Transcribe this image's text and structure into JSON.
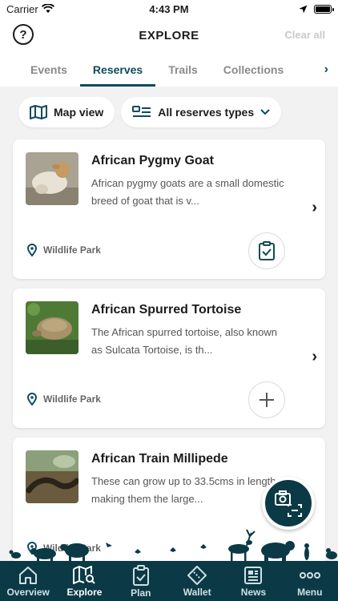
{
  "status": {
    "carrier": "Carrier",
    "time": "4:43 PM"
  },
  "header": {
    "title": "EXPLORE",
    "clear_all": "Clear all",
    "help": "?"
  },
  "tabs": [
    {
      "label": "Events"
    },
    {
      "label": "Reserves"
    },
    {
      "label": "Trails"
    },
    {
      "label": "Collections"
    }
  ],
  "filters": {
    "map_view": "Map view",
    "type_select": "All reserves types"
  },
  "cards": [
    {
      "title": "African Pygmy Goat",
      "desc": "African pygmy goats are a small domestic breed of goat that is v...",
      "location": "Wildlife Park",
      "action_icon": "clipboard-check-icon"
    },
    {
      "title": "African Spurred Tortoise",
      "desc": "The African spurred tortoise, also known as Sulcata Tortoise, is th...",
      "location": "Wildlife Park",
      "action_icon": "plus-icon"
    },
    {
      "title": "African Train Millipede",
      "desc": "These can grow up to 33.5cms in length, making them the large...",
      "location": "Wildlife Park",
      "action_icon": "plus-icon"
    }
  ],
  "nav": [
    {
      "label": "Overview",
      "icon": "home-icon"
    },
    {
      "label": "Explore",
      "icon": "map-search-icon"
    },
    {
      "label": "Plan",
      "icon": "clipboard-icon"
    },
    {
      "label": "Wallet",
      "icon": "ticket-icon"
    },
    {
      "label": "News",
      "icon": "newspaper-icon"
    },
    {
      "label": "Menu",
      "icon": "more-icon"
    }
  ],
  "colors": {
    "brand": "#0b3a46",
    "accent": "#0e4b5a"
  }
}
